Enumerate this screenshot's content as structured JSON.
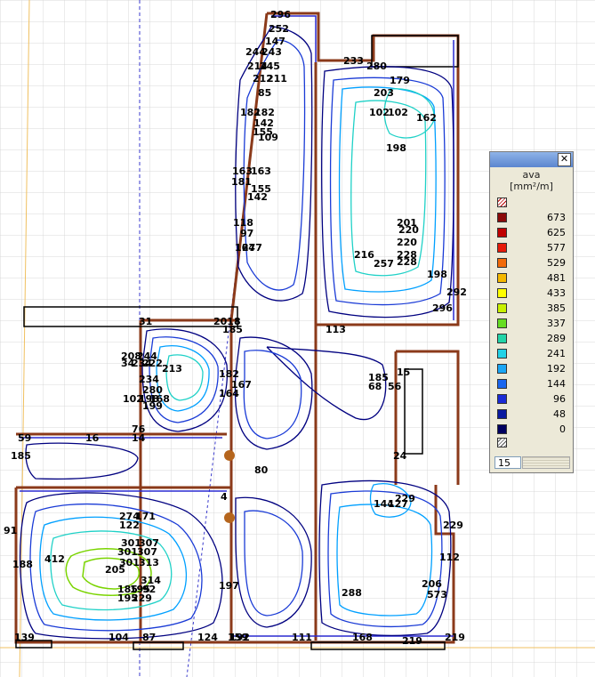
{
  "plan": {
    "labels": [
      "296",
      "252",
      "147",
      "244",
      "243",
      "214",
      "245",
      "212",
      "211",
      "85",
      "182",
      "182",
      "142",
      "155",
      "109",
      "163",
      "163",
      "181",
      "155",
      "142",
      "118",
      "97",
      "164",
      "277",
      "233",
      "280",
      "203",
      "102",
      "102",
      "162",
      "198",
      "201",
      "220",
      "220",
      "228",
      "228",
      "216",
      "257",
      "198",
      "292",
      "296",
      "113",
      "31",
      "2018",
      "185",
      "208",
      "244",
      "34",
      "234",
      "222",
      "234",
      "213",
      "280",
      "102",
      "198",
      "168",
      "199",
      "182",
      "167",
      "164",
      "185",
      "68",
      "56",
      "15",
      "76",
      "59",
      "16",
      "14",
      "185",
      "80",
      "24",
      "4",
      "229",
      "144",
      "127",
      "229",
      "112",
      "91",
      "274",
      "171",
      "122",
      "301",
      "307",
      "301",
      "307",
      "301",
      "313",
      "185",
      "195",
      "92",
      "314",
      "412",
      "205",
      "188",
      "195",
      "229",
      "197",
      "288",
      "206",
      "573",
      "139",
      "104",
      "87",
      "124",
      "159",
      "111",
      "168",
      "219",
      "219",
      "192",
      "179"
    ],
    "colors": {
      "contour_dark": "#000080",
      "contour_mid": "#1a3bd6",
      "contour_light": "#00a0ff",
      "contour_cyan": "#1fd1c7",
      "contour_green": "#7ad400",
      "wall": "#8b3a1a",
      "grid": "#d9d9d9",
      "axis": "#3a3acc"
    }
  },
  "legend": {
    "close_label": "✕",
    "title_line1": "ava",
    "title_line2": "[mm²/m]",
    "items": [
      {
        "value": "673",
        "color": "#8b0a0a"
      },
      {
        "value": "625",
        "color": "#c00000"
      },
      {
        "value": "577",
        "color": "#e61a0a"
      },
      {
        "value": "529",
        "color": "#f26a0a"
      },
      {
        "value": "481",
        "color": "#f5b800"
      },
      {
        "value": "433",
        "color": "#ffff00"
      },
      {
        "value": "385",
        "color": "#c8f000"
      },
      {
        "value": "337",
        "color": "#66dd22"
      },
      {
        "value": "289",
        "color": "#22d4a8"
      },
      {
        "value": "241",
        "color": "#22d2e6"
      },
      {
        "value": "192",
        "color": "#1aa6f5"
      },
      {
        "value": "144",
        "color": "#1a66ee"
      },
      {
        "value": "96",
        "color": "#1a2bd6"
      },
      {
        "value": "48",
        "color": "#0a1aa0"
      },
      {
        "value": "0",
        "color": "#000060"
      }
    ],
    "step_value": "15"
  }
}
